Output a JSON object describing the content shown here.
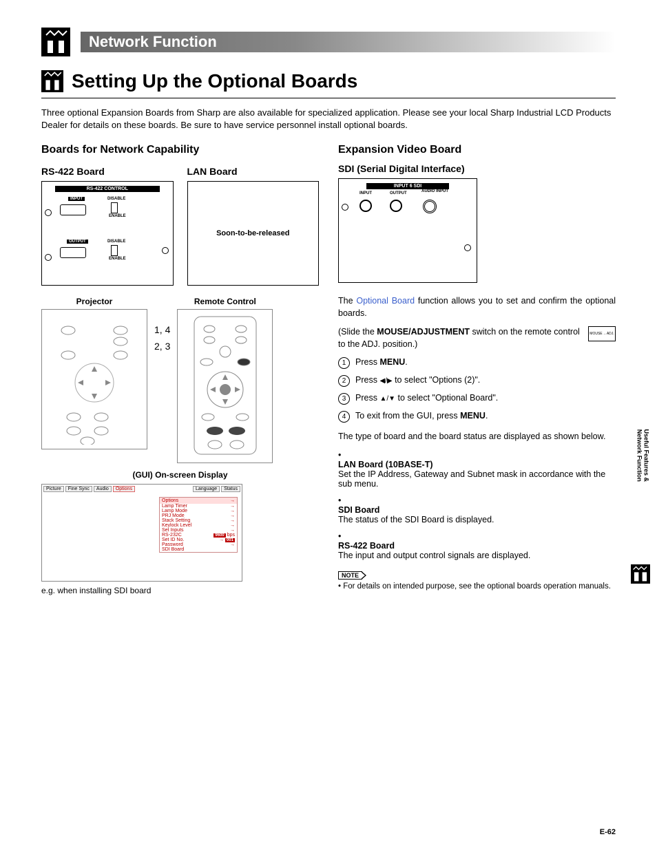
{
  "header": {
    "banner": "Network Function"
  },
  "title": "Setting Up the Optional Boards",
  "intro": "Three optional Expansion Boards from Sharp are also available for specialized application. Please see your local Sharp Industrial LCD Products Dealer for details on these boards. Be sure to have service personnel install optional boards.",
  "left": {
    "h3": "Boards for Network Capability",
    "rs422": {
      "h4": "RS-422 Board",
      "bar": "RS-422 CONTROL",
      "input": "INPUT",
      "output": "OUTPUT",
      "disable": "DISABLE",
      "enable": "ENABLE"
    },
    "lan": {
      "h4": "LAN Board",
      "text": "Soon-to-be-released"
    },
    "projector": "Projector",
    "remote": "Remote Control",
    "callouts": {
      "a": "1",
      "b": "4",
      "c": "2",
      "d": "3"
    },
    "gui_title": "(GUI) On-screen Display",
    "tabs": {
      "picture": "Picture",
      "fine": "Fine Sync",
      "audio": "Audio",
      "options": "Options",
      "lang": "Language",
      "status": "Status"
    },
    "options_panel": {
      "head": "Options",
      "rows": [
        "Lamp Timer",
        "Lamp Mode",
        "PRJ Mode",
        "Stack Setting",
        "Keylock Level",
        "Set Inputs",
        "RS-232C",
        "Set ID No.",
        "Password",
        "SDI Board"
      ],
      "bps": "9600",
      "bpslabel": "bps",
      "id": "001"
    },
    "gui_caption": "e.g. when installing SDI board"
  },
  "right": {
    "h3": "Expansion Video Board",
    "sdi": {
      "h4": "SDI (Serial Digital Interface)",
      "bar": "INPUT 6   SDI",
      "in": "INPUT",
      "out": "OUTPUT",
      "ain": "AUDIO INPUT"
    },
    "p1a": "The ",
    "p1link": "Optional Board",
    "p1b": " function allows you to set and confirm the optional boards.",
    "switch_a": "(Slide the ",
    "switch_b": "MOUSE/ADJUSTMENT",
    "switch_c": " switch on the remote control to the ADJ. position.)",
    "switch_icons": {
      "mouse": "MOUSE",
      "adj": "ADJ."
    },
    "steps": [
      {
        "n": "1",
        "pre": "Press ",
        "bold": "MENU",
        "post": "."
      },
      {
        "n": "2",
        "pre": "Press ",
        "tri": "◀/▶",
        "post": " to select \"Options (2)\"."
      },
      {
        "n": "3",
        "pre": "Press ",
        "tri": "▲/▼",
        "post": " to select \"Optional Board\"."
      },
      {
        "n": "4",
        "pre": "To exit from the GUI, press ",
        "bold": "MENU",
        "post": "."
      }
    ],
    "p2": "The type of board and the board status are displayed as shown below.",
    "bullets": [
      {
        "title": "LAN Board (10BASE-T)",
        "body": "Set the IP Address, Gateway and Subnet mask in accordance with the sub menu."
      },
      {
        "title": "SDI Board",
        "body": "The status of the SDI Board is displayed."
      },
      {
        "title": "RS-422 Board",
        "body": "The input and output control signals are displayed."
      }
    ],
    "note_tag": "NOTE",
    "note": "• For details on intended purpose, see the optional boards operation manuals."
  },
  "side": {
    "line1": "Useful Features &",
    "line2": "Network Function"
  },
  "pagenum": "E-62"
}
